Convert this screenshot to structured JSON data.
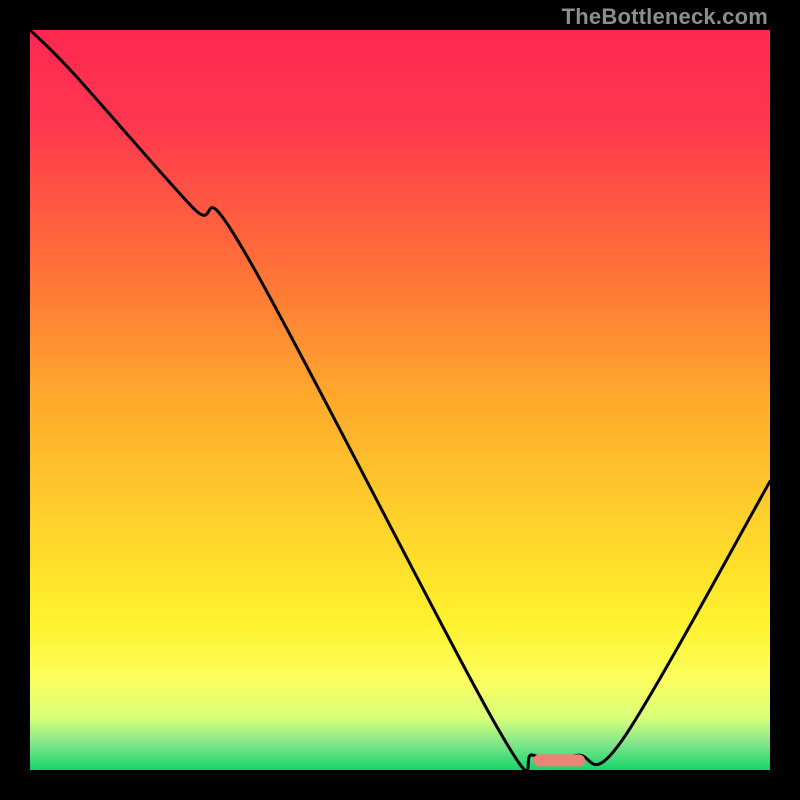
{
  "watermark": "TheBottleneck.com",
  "chart_data": {
    "type": "line",
    "title": "",
    "xlabel": "",
    "ylabel": "",
    "xlim": [
      0,
      100
    ],
    "ylim": [
      0,
      100
    ],
    "grid": false,
    "legend": false,
    "series": [
      {
        "name": "bottleneck-curve",
        "x": [
          0,
          6,
          22,
          29,
          63,
          68,
          74,
          80,
          100
        ],
        "values": [
          100,
          94,
          76,
          70,
          6,
          2,
          2,
          4,
          39
        ]
      }
    ],
    "marker": {
      "name": "highlight-segment",
      "x_start": 68,
      "x_end": 75,
      "y": 1.3,
      "color": "#ed8276"
    },
    "gradient_stops": [
      {
        "offset": 0.0,
        "color": "#ff2850"
      },
      {
        "offset": 0.12,
        "color": "#ff3650"
      },
      {
        "offset": 0.3,
        "color": "#ff6a3a"
      },
      {
        "offset": 0.5,
        "color": "#ffaa2c"
      },
      {
        "offset": 0.68,
        "color": "#ffd52c"
      },
      {
        "offset": 0.8,
        "color": "#fff22d"
      },
      {
        "offset": 0.88,
        "color": "#fcff60"
      },
      {
        "offset": 0.93,
        "color": "#d7ff7a"
      },
      {
        "offset": 0.965,
        "color": "#7fe68a"
      },
      {
        "offset": 1.0,
        "color": "#17d46a"
      }
    ]
  }
}
